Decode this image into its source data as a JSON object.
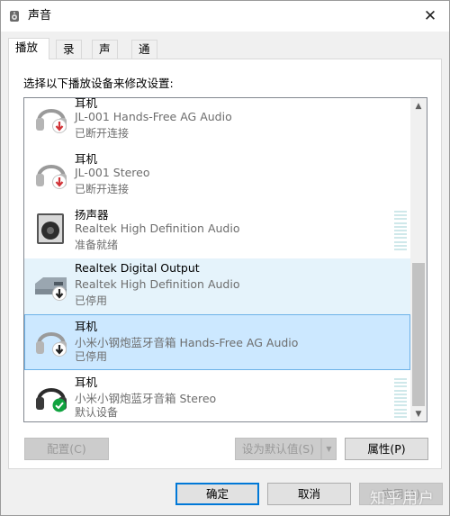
{
  "window": {
    "title": "声音",
    "close_symbol": "✕"
  },
  "tabs": [
    {
      "label": "播放",
      "active": true
    },
    {
      "label": "录制",
      "active": false
    },
    {
      "label": "声音",
      "active": false
    },
    {
      "label": "通信",
      "active": false
    }
  ],
  "instruction": "选择以下播放设备来修改设置:",
  "devices": [
    {
      "name": "耳机",
      "description": "JL-001 Hands-Free AG Audio",
      "status": "已断开连接",
      "icon": "headset-icon",
      "badge": "disconnected-arrow-icon"
    },
    {
      "name": "耳机",
      "description": "JL-001 Stereo",
      "status": "已断开连接",
      "icon": "headset-icon",
      "badge": "disconnected-arrow-icon"
    },
    {
      "name": "扬声器",
      "description": "Realtek High Definition Audio",
      "status": "准备就绪",
      "icon": "speaker-icon",
      "badge": "",
      "meter": true
    },
    {
      "name": "Realtek Digital Output",
      "description": "Realtek High Definition Audio",
      "status": "已停用",
      "icon": "digital-output-icon",
      "badge": "disabled-arrow-icon"
    },
    {
      "name": "耳机",
      "description": "小米小钢炮蓝牙音箱 Hands-Free AG Audio",
      "status": "已停用",
      "icon": "headset-icon",
      "badge": "disabled-arrow-icon",
      "selected": true
    },
    {
      "name": "耳机",
      "description": "小米小钢炮蓝牙音箱 Stereo",
      "status": "默认设备",
      "icon": "headset-icon",
      "badge": "default-check-icon",
      "meter": true
    }
  ],
  "buttons": {
    "configure": "配置(C)",
    "set_default": "设为默认值(S)",
    "properties": "属性(P)",
    "ok": "确定",
    "cancel": "取消",
    "apply": "应用(A)"
  },
  "watermark": "知乎用户",
  "colors": {
    "selection": "#cce8ff",
    "selection_border": "#6db2e8",
    "hover": "#e5f3fb",
    "accent": "#0078d7"
  }
}
